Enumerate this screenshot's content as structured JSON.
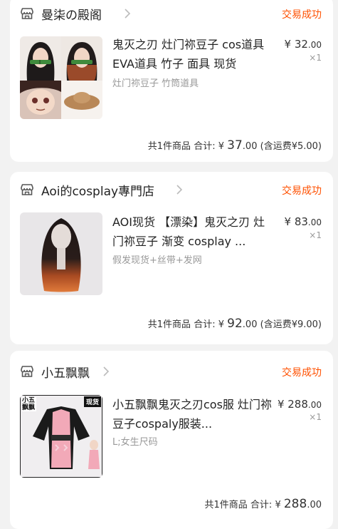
{
  "orders": [
    {
      "shop_name": "曼柒の殿阁",
      "status": "交易成功",
      "item_title": "鬼灭之刃 灶门祢豆子 cos道具 EVA道具 竹子 面具 现货",
      "price_symbol": "¥",
      "price_int": "32",
      "price_dec": ".00",
      "qty": "×1",
      "variant": "灶门祢豆子 竹筒道具",
      "summary_count": "共1件商品",
      "summary_total_label": "合计:",
      "summary_symbol": "¥",
      "summary_int": "37",
      "summary_dec": ".00",
      "summary_shipping": "(含运费¥5.00)"
    },
    {
      "shop_name": "Aoi的cosplay專門店",
      "status": "交易成功",
      "item_title": "AOI现货 【漂染】鬼灭之刃 灶门祢豆子 渐变 cosplay ...",
      "price_symbol": "¥",
      "price_int": "83",
      "price_dec": ".00",
      "qty": "×1",
      "variant": "假发现货+丝带+发网",
      "summary_count": "共1件商品",
      "summary_total_label": "合计:",
      "summary_symbol": "¥",
      "summary_int": "92",
      "summary_dec": ".00",
      "summary_shipping": "(含运费¥9.00)"
    },
    {
      "shop_name": "小五飘飘",
      "status": "交易成功",
      "item_title": "小五飘飘鬼灭之刃cos服 灶门祢豆子cospaly服装...",
      "price_symbol": "¥",
      "price_int": "288",
      "price_dec": ".00",
      "qty": "×1",
      "variant": "L;女生尺码",
      "summary_count": "共1件商品",
      "summary_total_label": "合计:",
      "summary_symbol": "¥",
      "summary_int": "288",
      "summary_dec": ".00",
      "thumb_badge_left": "小五 飘飘",
      "thumb_badge_right": "现货"
    }
  ],
  "colors": {
    "accent": "#ff5000",
    "background": "#f2f2f2",
    "card": "#ffffff",
    "muted": "#999999"
  },
  "icons": {
    "shop": "shop-icon",
    "chevron": "chevron-right-icon"
  }
}
